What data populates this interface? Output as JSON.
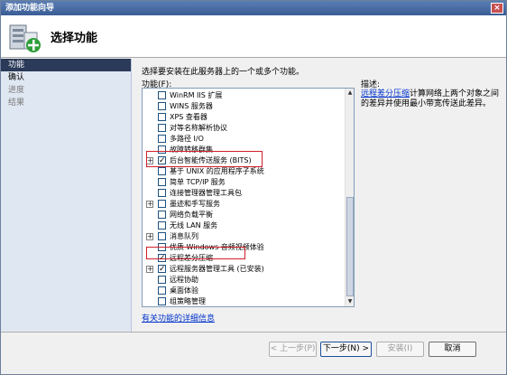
{
  "window": {
    "title": "添加功能向导",
    "close": "×"
  },
  "header": {
    "title": "选择功能"
  },
  "nav": {
    "items": [
      {
        "label": "功能",
        "state": "active"
      },
      {
        "label": "确认",
        "state": "normal"
      },
      {
        "label": "进度",
        "state": "disabled"
      },
      {
        "label": "结果",
        "state": "disabled"
      }
    ]
  },
  "main": {
    "instruction": "选择要安装在此服务器上的一个或多个功能。",
    "features_label": "功能(F):",
    "features": [
      {
        "label": "WinRM IIS 扩展",
        "checked": false,
        "expandable": false,
        "indent": 0
      },
      {
        "label": "WINS 服务器",
        "checked": false,
        "expandable": false,
        "indent": 0
      },
      {
        "label": "XPS 查看器",
        "checked": false,
        "expandable": false,
        "indent": 0
      },
      {
        "label": "对等名称解析协议",
        "checked": false,
        "expandable": false,
        "indent": 0
      },
      {
        "label": "多路径 I/O",
        "checked": false,
        "expandable": false,
        "indent": 0
      },
      {
        "label": "故障转移群集",
        "checked": false,
        "expandable": false,
        "indent": 0
      },
      {
        "label": "后台智能传送服务 (BITS)",
        "checked": true,
        "expandable": true,
        "indent": 0
      },
      {
        "label": "基于 UNIX 的应用程序子系统",
        "checked": false,
        "expandable": false,
        "indent": 0
      },
      {
        "label": "简单 TCP/IP 服务",
        "checked": false,
        "expandable": false,
        "indent": 0
      },
      {
        "label": "连接管理器管理工具包",
        "checked": false,
        "expandable": false,
        "indent": 0
      },
      {
        "label": "墨迹和手写服务",
        "checked": false,
        "expandable": true,
        "indent": 0
      },
      {
        "label": "网络负载平衡",
        "checked": false,
        "expandable": false,
        "indent": 0
      },
      {
        "label": "无线 LAN 服务",
        "checked": false,
        "expandable": false,
        "indent": 0
      },
      {
        "label": "消息队列",
        "checked": false,
        "expandable": true,
        "indent": 0
      },
      {
        "label": "优质 Windows 音频视频体验",
        "checked": false,
        "expandable": false,
        "indent": 0
      },
      {
        "label": "远程差分压缩",
        "checked": true,
        "expandable": false,
        "indent": 0
      },
      {
        "label": "远程服务器管理工具  (已安装)",
        "checked": true,
        "expandable": true,
        "indent": 0
      },
      {
        "label": "远程协助",
        "checked": false,
        "expandable": false,
        "indent": 0
      },
      {
        "label": "桌面体验",
        "checked": false,
        "expandable": false,
        "indent": 0
      },
      {
        "label": "组策略管理",
        "checked": false,
        "expandable": false,
        "indent": 0
      }
    ],
    "more_info_link": "有关功能的详细信息"
  },
  "description": {
    "label": "描述:",
    "link": "远程差分压缩",
    "text": "计算网络上两个对象之间的差异并使用最小带宽传送此差异。"
  },
  "buttons": {
    "prev": "< 上一步(P)",
    "next": "下一步(N) >",
    "install": "安装(I)",
    "cancel": "取消"
  },
  "colors": {
    "nav_bg": "#dfe7f2",
    "nav_active": "#2b3a58",
    "highlight": "#d21f2a",
    "link": "#0033cc"
  }
}
